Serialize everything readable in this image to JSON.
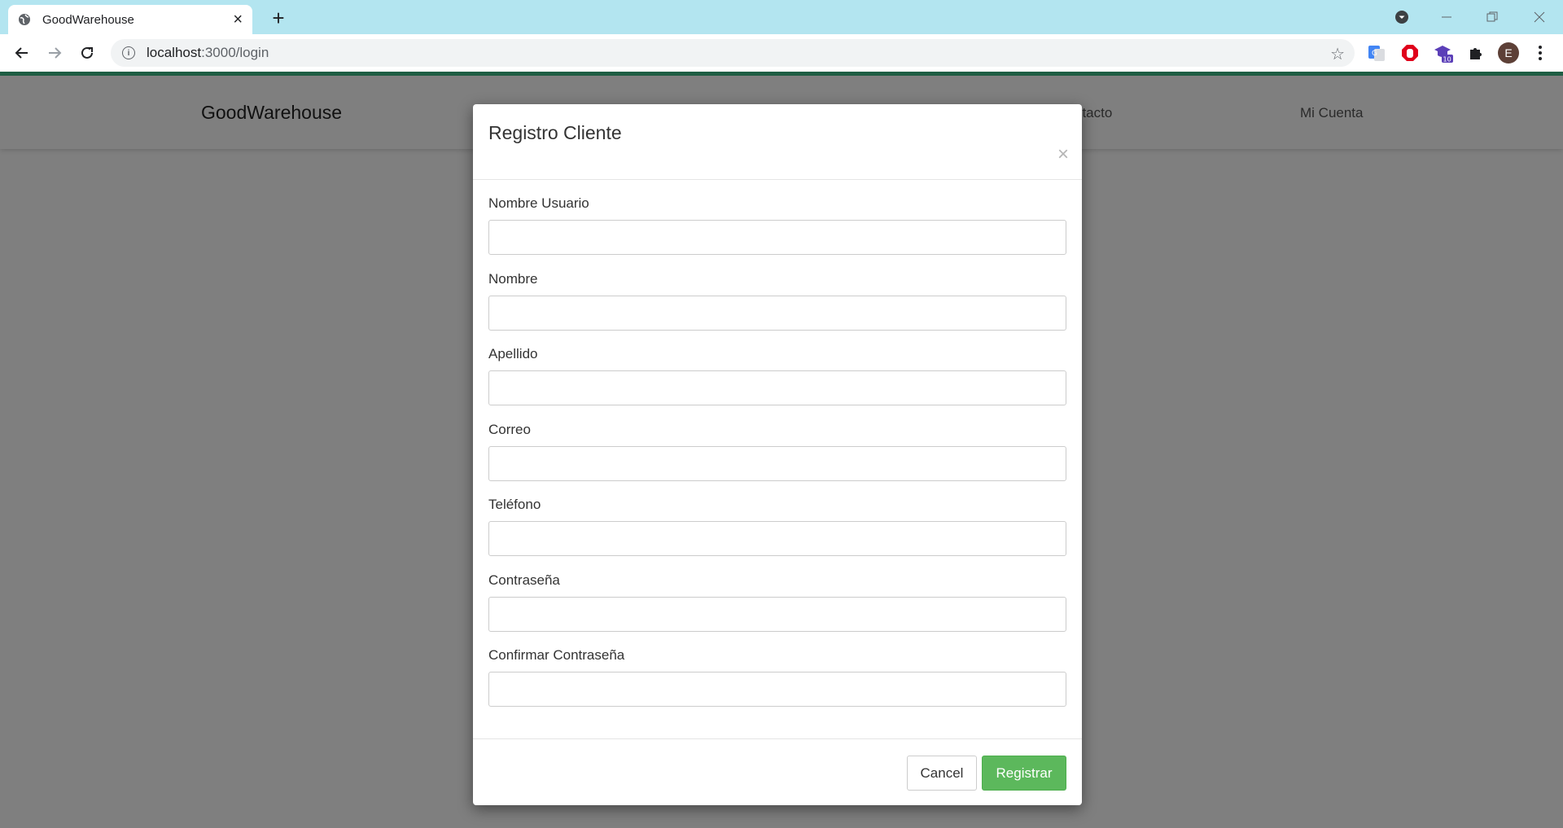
{
  "browser": {
    "tab_title": "GoodWarehouse",
    "tab_close": "×",
    "new_tab": "+",
    "url_host": "localhost",
    "url_path": ":3000/login",
    "extension_badge": "10",
    "profile_initial": "E",
    "accent_color": "#1f5f45"
  },
  "navbar": {
    "brand": "GoodWarehouse",
    "links": [
      "ntacto",
      "Mi Cuenta"
    ]
  },
  "modal": {
    "title": "Registro Cliente",
    "close_symbol": "×",
    "fields": [
      {
        "label": "Nombre Usuario",
        "value": ""
      },
      {
        "label": "Nombre",
        "value": ""
      },
      {
        "label": "Apellido",
        "value": ""
      },
      {
        "label": "Correo",
        "value": ""
      },
      {
        "label": "Teléfono",
        "value": ""
      },
      {
        "label": "Contraseña",
        "value": ""
      },
      {
        "label": "Confirmar Contraseña",
        "value": ""
      }
    ],
    "cancel_label": "Cancel",
    "submit_label": "Registrar",
    "submit_color": "#5cb85c"
  }
}
